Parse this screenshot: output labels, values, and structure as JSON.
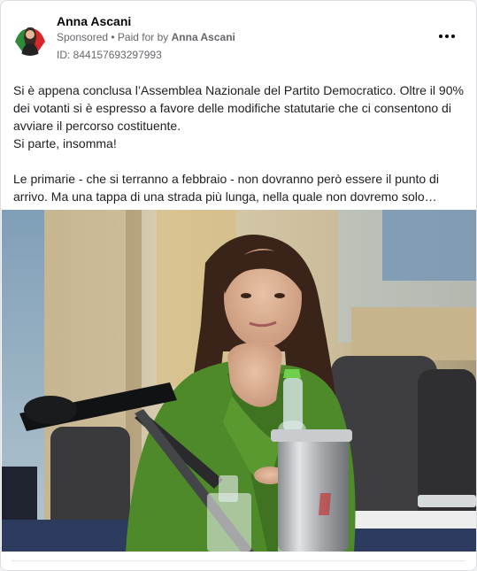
{
  "post": {
    "author": "Anna Ascani",
    "sponsored_label": "Sponsored",
    "separator": " • ",
    "paid_for_prefix": "Paid for by ",
    "paid_for_name": "Anna Ascani",
    "id_label": "ID: 844157693297993",
    "paragraph_1": "Si è appena conclusa l’Assemblea Nazionale del Partito Democratico. Oltre il 90% dei votanti si è espresso a favore delle modifiche statutarie che ci consentono di avviare il percorso costituente.\nSi parte, insomma!",
    "paragraph_2": "Le primarie - che si terranno a febbraio - non dovranno però essere il punto di arrivo. Ma una tappa di una strada più lunga, nella quale non dovremo solo…"
  },
  "icons": {
    "more": "more-options-icon",
    "avatar": "profile-avatar",
    "photo": "post-photo"
  },
  "colors": {
    "author_text": "#050505",
    "meta_text": "#65676b",
    "body_text": "#1c1e21",
    "jacket_green": "#4f8a2a"
  }
}
